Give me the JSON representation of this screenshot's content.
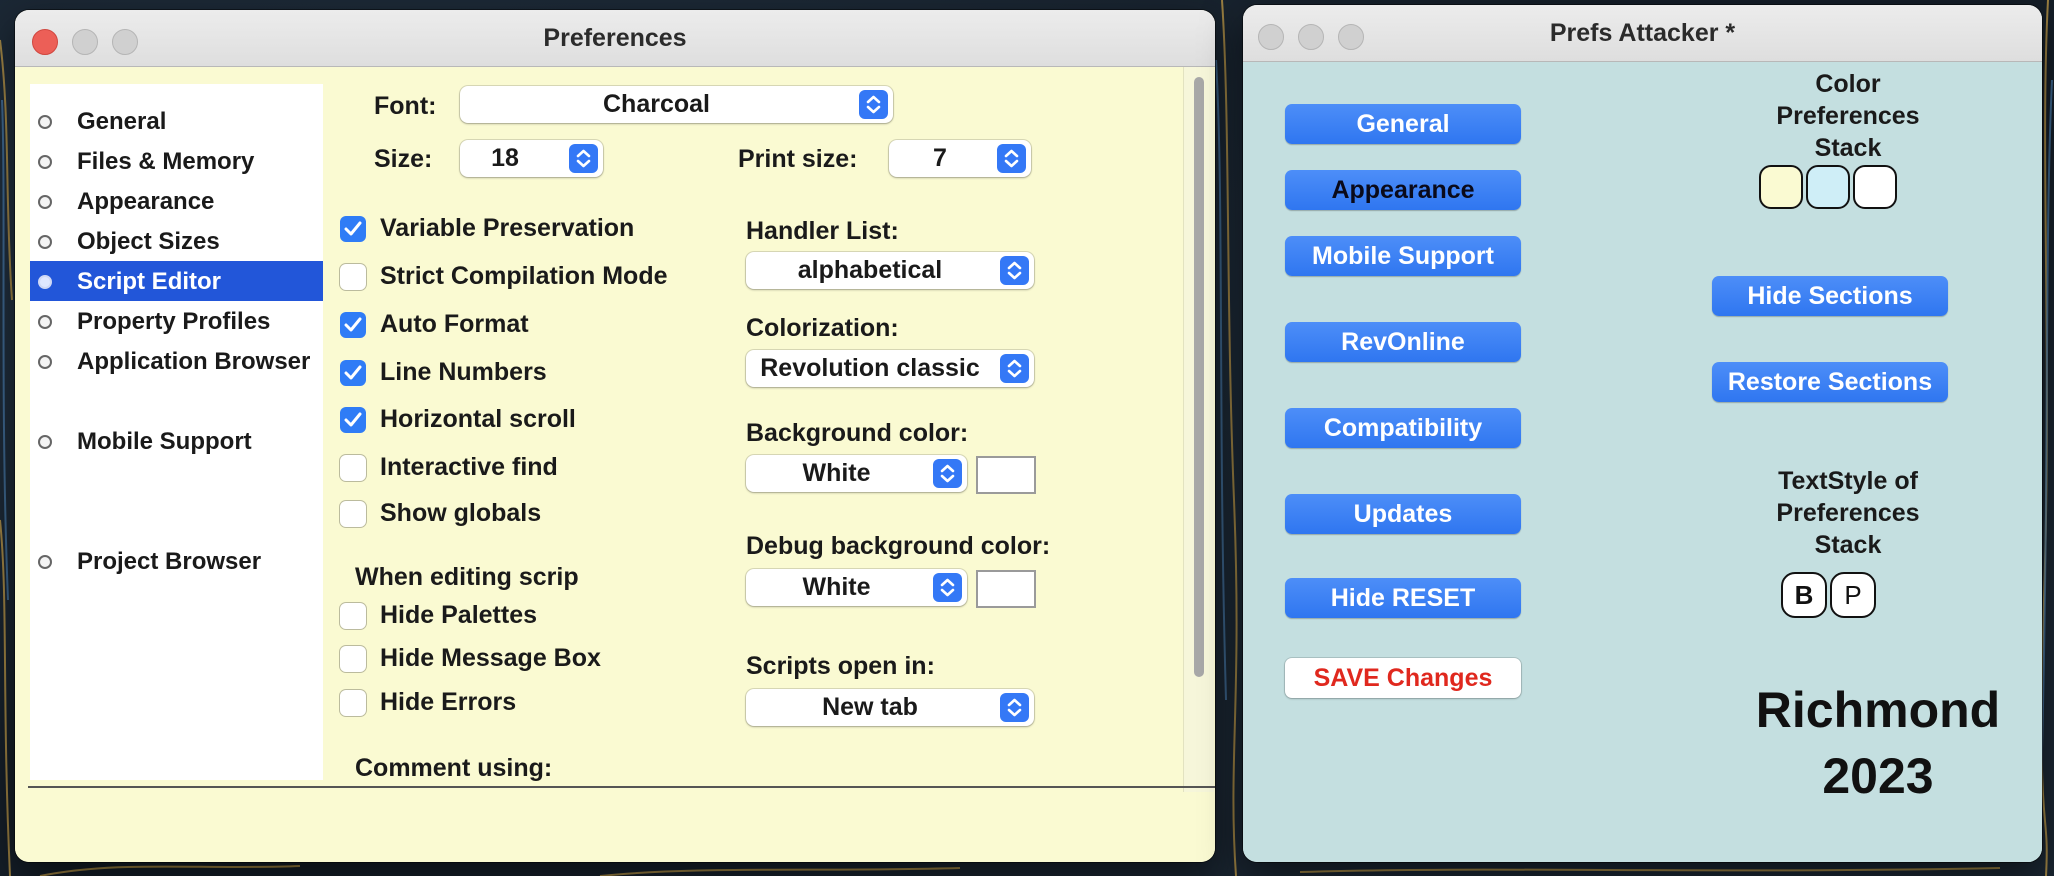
{
  "prefs": {
    "title": "Preferences",
    "sidebar": [
      {
        "label": "General"
      },
      {
        "label": "Files & Memory"
      },
      {
        "label": "Appearance"
      },
      {
        "label": "Object Sizes"
      },
      {
        "label": "Script Editor",
        "selected": true
      },
      {
        "label": "Property Profiles"
      },
      {
        "label": "Application Browser"
      },
      {
        "label": "Mobile Support"
      },
      {
        "label": "Project Browser"
      }
    ],
    "font_label": "Font:",
    "font_value": "Charcoal",
    "size_label": "Size:",
    "size_value": "18",
    "print_size_label": "Print size:",
    "print_size_value": "7",
    "checkboxes": [
      {
        "label": "Variable Preservation",
        "checked": true
      },
      {
        "label": "Strict Compilation Mode",
        "checked": false
      },
      {
        "label": "Auto Format",
        "checked": true
      },
      {
        "label": "Line Numbers",
        "checked": true
      },
      {
        "label": "Horizontal scroll",
        "checked": true
      },
      {
        "label": "Interactive find",
        "checked": false
      },
      {
        "label": "Show globals",
        "checked": false
      }
    ],
    "editing_heading": "When editing scrip",
    "editing_checkboxes": [
      {
        "label": "Hide Palettes",
        "checked": false
      },
      {
        "label": "Hide Message Box",
        "checked": false
      },
      {
        "label": "Hide Errors",
        "checked": false
      }
    ],
    "comment_label": "Comment using:",
    "handler_list_label": "Handler List:",
    "handler_list_value": "alphabetical",
    "colorization_label": "Colorization:",
    "colorization_value": "Revolution classic",
    "background_color_label": "Background color:",
    "background_color_value": "White",
    "debug_background_label": "Debug background color:",
    "debug_background_value": "White",
    "scripts_open_label": "Scripts open in:",
    "scripts_open_value": "New tab"
  },
  "attacker": {
    "title": "Prefs Attacker *",
    "buttons": {
      "general": "General",
      "appearance": "Appearance",
      "mobile": "Mobile Support",
      "revonline": "RevOnline",
      "compatibility": "Compatibility",
      "updates": "Updates",
      "hide_reset": "Hide RESET",
      "save": "SAVE Changes",
      "hide_sections": "Hide Sections",
      "restore_sections": "Restore Sections"
    },
    "color_prefs_label": "Color\nPreferences\nStack",
    "color_swatches": [
      "#fafad2",
      "#cfeef7",
      "#ffffff"
    ],
    "textstyle_label": "TextStyle of\nPreferences\nStack",
    "textstyle_buttons": [
      "B",
      "P"
    ],
    "brand_line1": "Richmond",
    "brand_line2": "2023"
  },
  "colors": {
    "prefs_bg": "#fafad2",
    "attacker_bg": "#c4dfe0",
    "accent": "#2f76f0",
    "selection": "#2256d9",
    "save_text": "#e0281e"
  }
}
